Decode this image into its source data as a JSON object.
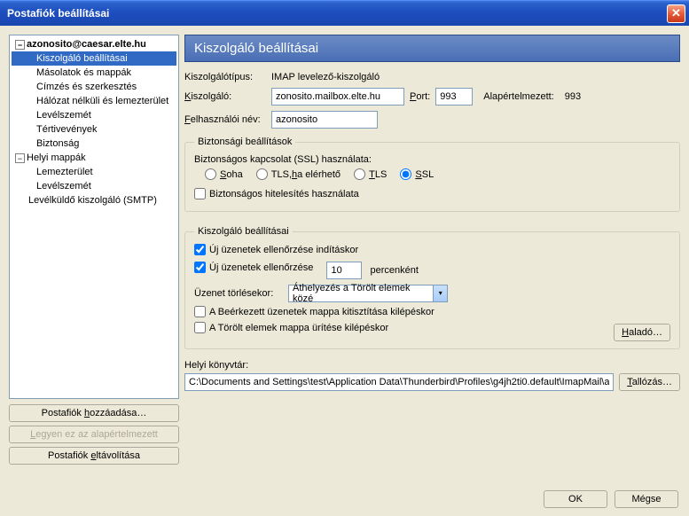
{
  "window": {
    "title": "Postafiók beállításai"
  },
  "tree": {
    "account": "azonosito@caesar.elte.hu",
    "items": [
      "Kiszolgáló beállításai",
      "Másolatok és mappák",
      "Címzés és szerkesztés",
      "Hálózat nélküli és lemezterület",
      "Levélszemét",
      "Tértivevények",
      "Biztonság"
    ],
    "local_folders": "Helyi mappák",
    "local_items": [
      "Lemezterület",
      "Levélszemét"
    ],
    "smtp": "Levélküldő kiszolgáló (SMTP)"
  },
  "sidebar_buttons": {
    "add": "Postafiók hozzáadása…",
    "default": "Legyen ez az alapértelmezett",
    "remove": "Postafiók eltávolítása"
  },
  "header": "Kiszolgáló beállításai",
  "row1": {
    "label": "Kiszolgálótípus:",
    "value": "IMAP levelező-kiszolgáló"
  },
  "row2": {
    "label": "Kiszolgáló:",
    "value": "zonosito.mailbox.elte.hu",
    "port_label": "Port:",
    "port_value": "993",
    "default_label": "Alapértelmezett:",
    "default_value": "993"
  },
  "row3": {
    "label": "Felhasználói név:",
    "value": "azonosito"
  },
  "group1": {
    "legend": "Biztonsági beállítások",
    "ssl_label": "Biztonságos kapcsolat (SSL) használata:",
    "options": {
      "never": "Soha",
      "tls_avail": "TLS, ha elérhető",
      "tls": "TLS",
      "ssl": "SSL"
    },
    "auth_label": "Biztonságos hitelesítés használata"
  },
  "group2": {
    "legend": "Kiszolgáló beállításai",
    "check_startup": "Új üzenetek ellenőrzése indításkor",
    "check_every": "Új üzenetek ellenőrzése",
    "interval": "10",
    "minutes": "percenként",
    "delete_label": "Üzenet törlésekor:",
    "delete_value": "Áthelyezés a Törölt elemek közé",
    "cleanup_inbox": "A Beérkezett üzenetek mappa kitisztítása kilépéskor",
    "empty_trash": "A Törölt elemek mappa ürítése kilépéskor",
    "advanced": "Haladó…"
  },
  "local_dir": {
    "label": "Helyi könyvtár:",
    "value": "C:\\Documents and Settings\\test\\Application Data\\Thunderbird\\Profiles\\g4jh2ti0.default\\ImapMail\\a",
    "browse": "Tallózás…"
  },
  "footer": {
    "ok": "OK",
    "cancel": "Mégse"
  }
}
